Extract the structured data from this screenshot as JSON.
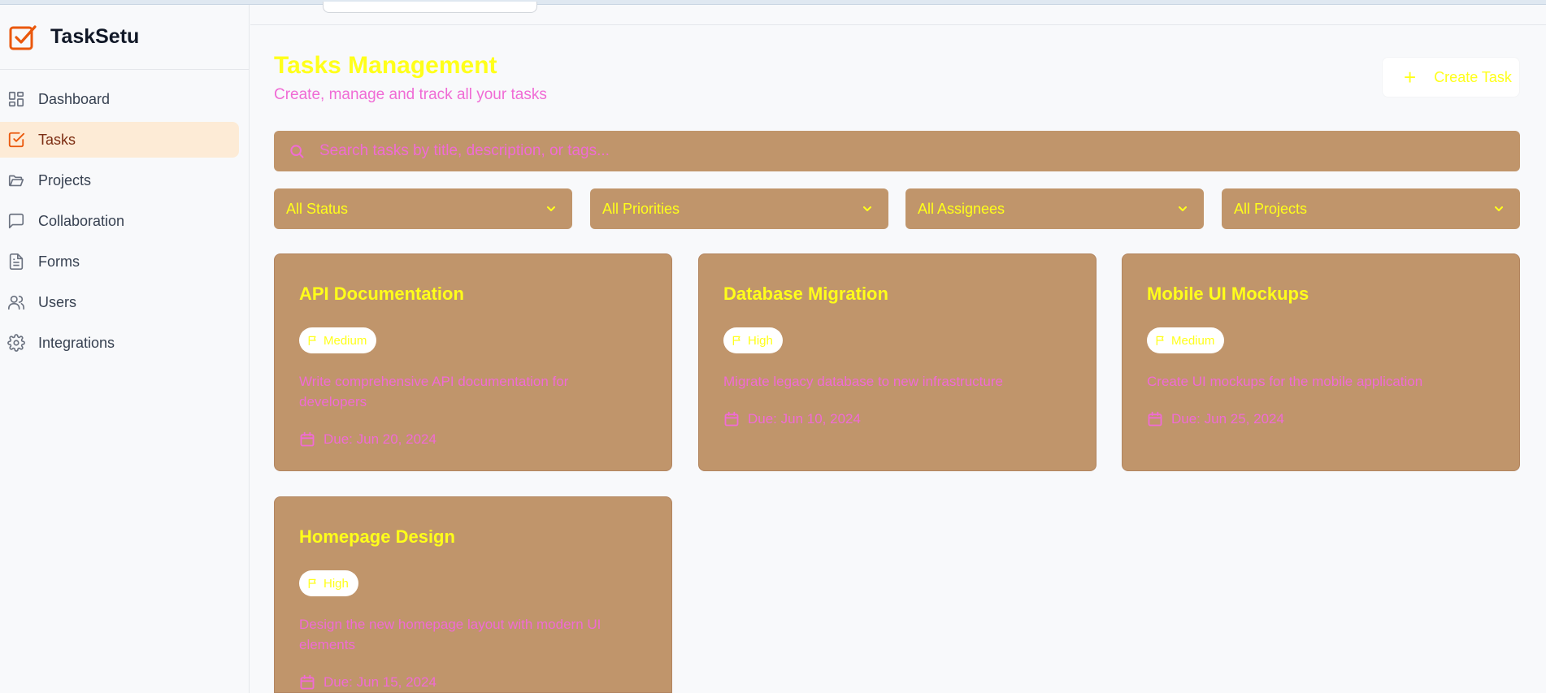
{
  "app": {
    "name": "TaskSetu"
  },
  "sidebar": {
    "items": [
      {
        "label": "Dashboard",
        "icon": "dashboard-icon"
      },
      {
        "label": "Tasks",
        "icon": "tasks-icon",
        "active": true
      },
      {
        "label": "Projects",
        "icon": "folder-icon"
      },
      {
        "label": "Collaboration",
        "icon": "chat-icon"
      },
      {
        "label": "Forms",
        "icon": "document-icon"
      },
      {
        "label": "Users",
        "icon": "users-icon"
      },
      {
        "label": "Integrations",
        "icon": "gear-icon"
      }
    ]
  },
  "header": {
    "title": "Tasks Management",
    "subtitle": "Create, manage and track all your tasks",
    "create_label": "Create Task"
  },
  "search": {
    "placeholder": "Search tasks by title, description, or tags..."
  },
  "filters": [
    {
      "label": "All Status"
    },
    {
      "label": "All Priorities"
    },
    {
      "label": "All Assignees"
    },
    {
      "label": "All Projects"
    }
  ],
  "tasks": [
    {
      "title": "API Documentation",
      "priority": "Medium",
      "description": "Write comprehensive API documentation for developers",
      "due": "Due: Jun 20, 2024"
    },
    {
      "title": "Database Migration",
      "priority": "High",
      "description": "Migrate legacy database to new infrastructure",
      "due": "Due: Jun 10, 2024"
    },
    {
      "title": "Mobile UI Mockups",
      "priority": "Medium",
      "description": "Create UI mockups for the mobile application",
      "due": "Due: Jun 25, 2024"
    },
    {
      "title": "Homepage Design",
      "priority": "High",
      "description": "Design the new homepage layout with modern UI elements",
      "due": "Due: Jun 15, 2024"
    }
  ],
  "colors": {
    "brand": "#ea580c",
    "card": "#c0956b",
    "accent_text": "#ffff1a",
    "secondary_text": "#f06bd5",
    "active_nav": "#fdebd6"
  }
}
